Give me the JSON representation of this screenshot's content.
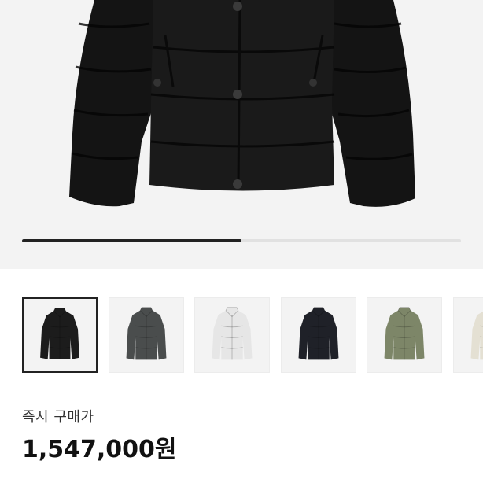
{
  "product": {
    "image_alt": "black puffer jacket",
    "image_progress": 0.5
  },
  "thumbnails": [
    {
      "name": "black",
      "color": "#1c1c1c",
      "selected": true
    },
    {
      "name": "dark-grey",
      "color": "#4a4d4d",
      "selected": false
    },
    {
      "name": "white",
      "color": "#e6e6e6",
      "selected": false
    },
    {
      "name": "navy-black",
      "color": "#1f2128",
      "selected": false
    },
    {
      "name": "olive",
      "color": "#7d8668",
      "selected": false
    },
    {
      "name": "ivory",
      "color": "#e4e0d3",
      "selected": false
    }
  ],
  "price": {
    "label": "즉시 구매가",
    "value": "1,547,000원"
  },
  "colors": {
    "progress_track": "#e1e1e1",
    "progress_fill": "#222222",
    "selected_border": "#222222"
  }
}
